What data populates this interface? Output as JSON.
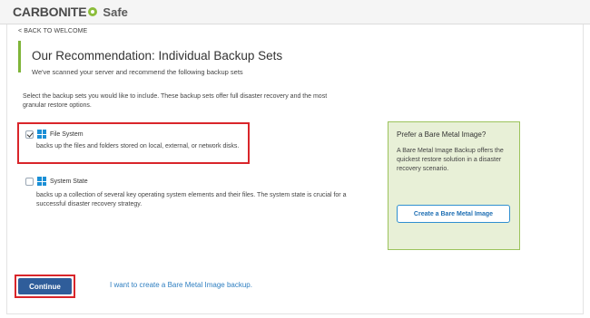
{
  "header": {
    "brand": "CARBONITE",
    "product": "Safe"
  },
  "nav": {
    "back_label": "< BACK TO WELCOME"
  },
  "page": {
    "title": "Our Recommendation: Individual Backup Sets",
    "subtitle": "We've scanned your server and recommend the following backup sets",
    "intro": "Select the backup sets you would like to include.  These backup sets offer full disaster recovery and the most granular restore options."
  },
  "options": [
    {
      "label": "File System",
      "description": "backs up the files and folders stored on local, external, or network disks.",
      "checked": true
    },
    {
      "label": "System State",
      "description": "backs up a collection of several key operating system elements and their files. The system state is crucial for a successful disaster recovery strategy.",
      "checked": false
    }
  ],
  "sidebar": {
    "title": "Prefer a Bare Metal Image?",
    "text": "A Bare Metal Image Backup offers the quickest restore solution in a disaster recovery scenario.",
    "button_label": "Create a Bare Metal Image"
  },
  "footer": {
    "continue_label": "Continue",
    "bare_metal_link": "I want to create a Bare Metal Image backup."
  },
  "colors": {
    "accent_green": "#7fb539",
    "highlight_red": "#d9252a",
    "primary_blue": "#2f5d9a",
    "link_blue": "#2f7fc1",
    "windows_blue": "#1a8fd6"
  },
  "icons": {
    "logo_mark": "carbonite-dot-icon",
    "option_icon": "windows-icon",
    "checkbox": "checkbox-icon"
  }
}
